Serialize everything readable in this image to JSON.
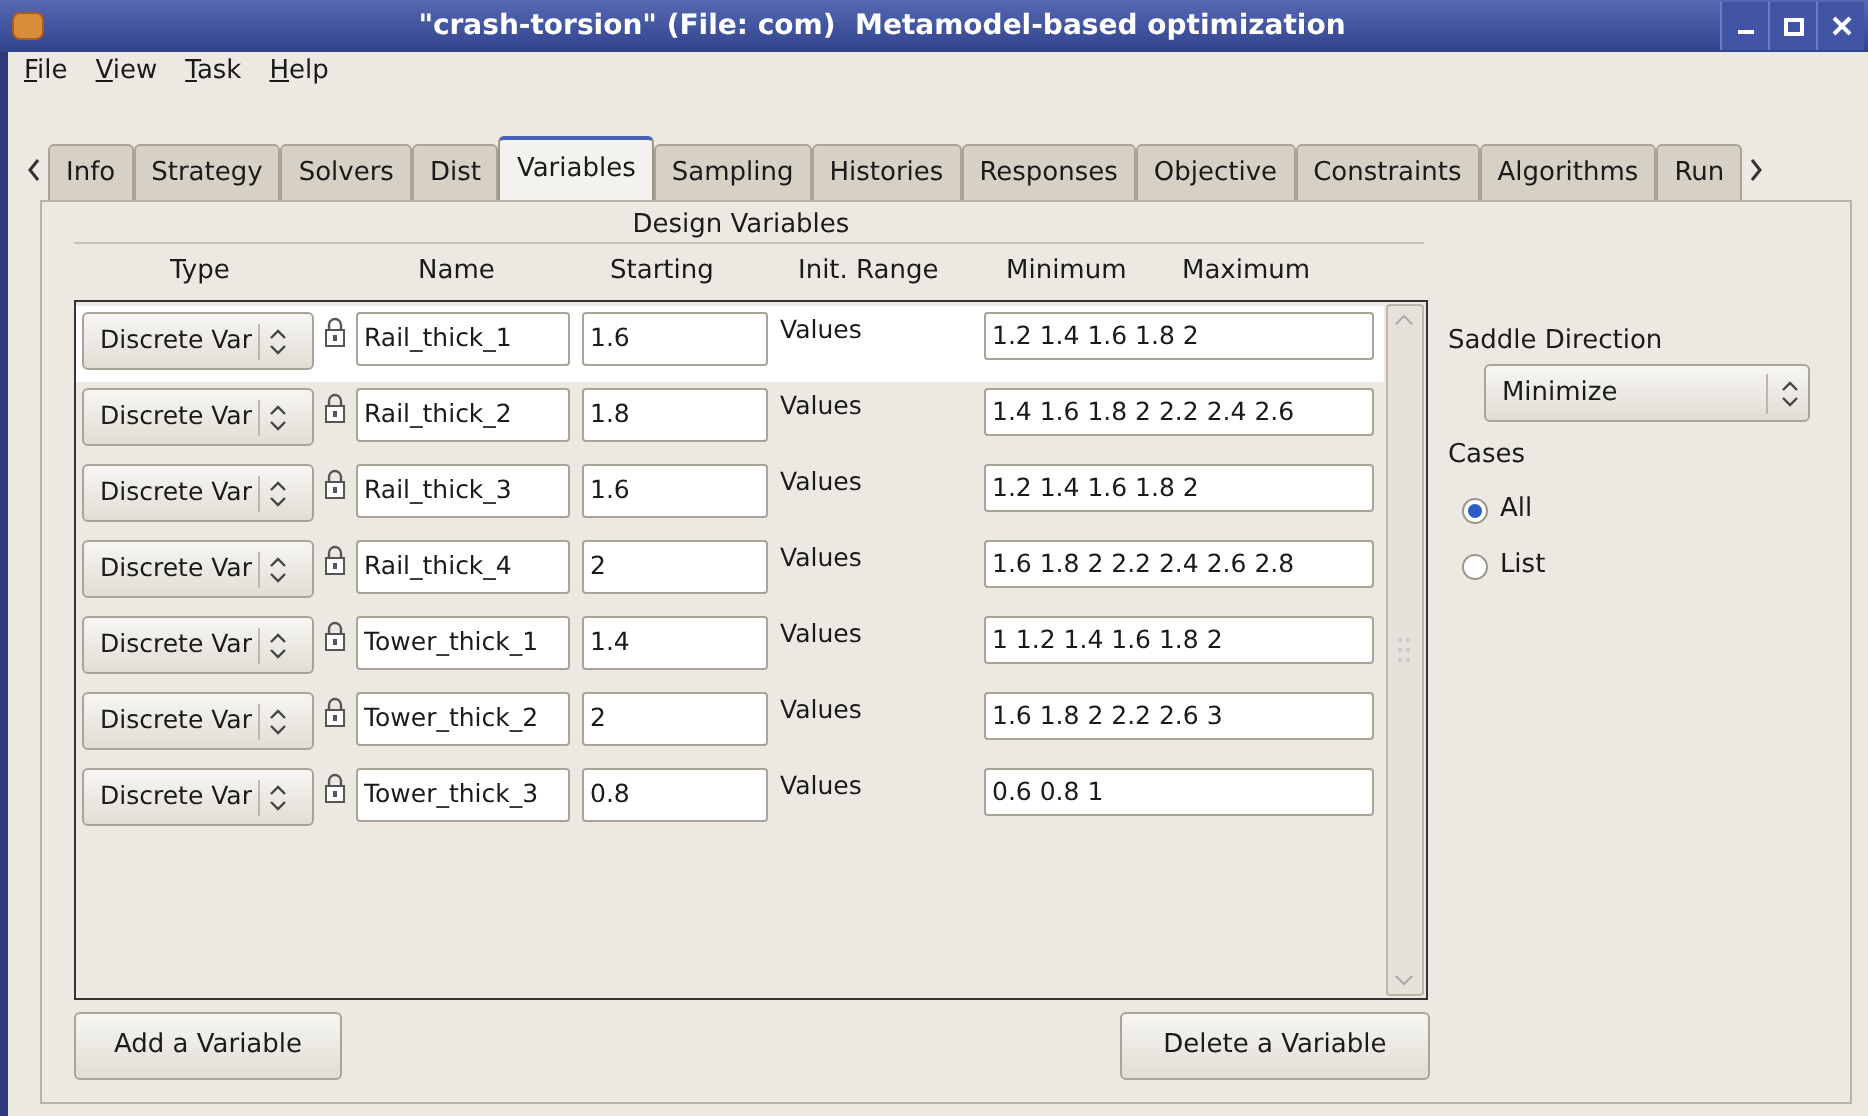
{
  "window": {
    "title": "\"crash-torsion\" (File: com)  Metamodel-based optimization"
  },
  "menu": [
    {
      "label": "File"
    },
    {
      "label": "View"
    },
    {
      "label": "Task"
    },
    {
      "label": "Help"
    }
  ],
  "tabs": [
    {
      "label": "Info",
      "selected": false
    },
    {
      "label": "Strategy",
      "selected": false
    },
    {
      "label": "Solvers",
      "selected": false
    },
    {
      "label": "Dist",
      "selected": false
    },
    {
      "label": "Variables",
      "selected": true
    },
    {
      "label": "Sampling",
      "selected": false
    },
    {
      "label": "Histories",
      "selected": false
    },
    {
      "label": "Responses",
      "selected": false
    },
    {
      "label": "Objective",
      "selected": false
    },
    {
      "label": "Constraints",
      "selected": false
    },
    {
      "label": "Algorithms",
      "selected": false
    },
    {
      "label": "Run",
      "selected": false
    }
  ],
  "design_variables": {
    "title": "Design Variables",
    "columns": [
      "Type",
      "Name",
      "Starting",
      "Init. Range",
      "Minimum",
      "Maximum"
    ],
    "rows": [
      {
        "type": "Discrete Var",
        "name": "Rail_thick_1",
        "starting": "1.6",
        "range_label": "Values",
        "values": "1.2 1.4 1.6 1.8 2",
        "selected": true
      },
      {
        "type": "Discrete Var",
        "name": "Rail_thick_2",
        "starting": "1.8",
        "range_label": "Values",
        "values": "1.4 1.6 1.8 2 2.2 2.4 2.6",
        "selected": false
      },
      {
        "type": "Discrete Var",
        "name": "Rail_thick_3",
        "starting": "1.6",
        "range_label": "Values",
        "values": "1.2 1.4 1.6 1.8 2",
        "selected": false
      },
      {
        "type": "Discrete Var",
        "name": "Rail_thick_4",
        "starting": "2",
        "range_label": "Values",
        "values": "1.6 1.8 2 2.2 2.4 2.6 2.8",
        "selected": false
      },
      {
        "type": "Discrete Var",
        "name": "Tower_thick_1",
        "starting": "1.4",
        "range_label": "Values",
        "values": "1 1.2 1.4 1.6 1.8 2",
        "selected": false
      },
      {
        "type": "Discrete Var",
        "name": "Tower_thick_2",
        "starting": "2",
        "range_label": "Values",
        "values": "1.6 1.8 2 2.2 2.6 3",
        "selected": false
      },
      {
        "type": "Discrete Var",
        "name": "Tower_thick_3",
        "starting": "0.8",
        "range_label": "Values",
        "values": "0.6 0.8 1",
        "selected": false
      }
    ],
    "buttons": [
      "Add a Variable",
      "Delete a Variable"
    ]
  },
  "saddle_direction": {
    "label": "Saddle Direction",
    "value": "Minimize"
  },
  "cases": {
    "label": "Cases",
    "options": [
      {
        "label": "All",
        "selected": true
      },
      {
        "label": "List",
        "selected": false
      }
    ]
  }
}
